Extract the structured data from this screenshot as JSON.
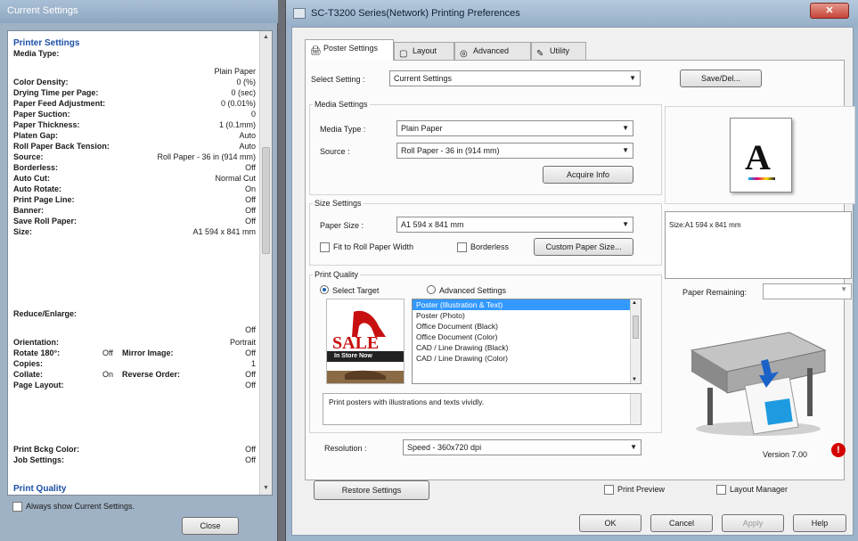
{
  "left_window": {
    "title": "Current Settings",
    "section_printer": "Printer Settings",
    "media_type_label": "Media Type:",
    "media_type_value": "Plain Paper",
    "rows1": [
      {
        "label": "Color Density:",
        "value": "0 (%)"
      },
      {
        "label": "Drying Time per Page:",
        "value": "0 (sec)"
      },
      {
        "label": "Paper Feed Adjustment:",
        "value": "0 (0.01%)"
      },
      {
        "label": "Paper Suction:",
        "value": "0"
      },
      {
        "label": "Paper Thickness:",
        "value": "1 (0.1mm)"
      },
      {
        "label": "Platen Gap:",
        "value": "Auto"
      },
      {
        "label": "Roll Paper Back Tension:",
        "value": "Auto"
      },
      {
        "label": "Source:",
        "value": "Roll Paper - 36 in (914 mm)"
      },
      {
        "label": "Borderless:",
        "value": "Off"
      },
      {
        "label": "Auto Cut:",
        "value": "Normal Cut"
      },
      {
        "label": "Auto Rotate:",
        "value": "On"
      },
      {
        "label": "Print Page Line:",
        "value": "Off"
      },
      {
        "label": "Banner:",
        "value": "Off"
      },
      {
        "label": "Save Roll Paper:",
        "value": "Off"
      },
      {
        "label": "Size:",
        "value": "A1 594 x 841 mm"
      }
    ],
    "reduce_label": "Reduce/Enlarge:",
    "reduce_value": "Off",
    "orientation_label": "Orientation:",
    "orientation_value": "Portrait",
    "rotate_label": "Rotate 180°:",
    "rotate_value": "Off",
    "mirror_label": "Mirror Image:",
    "mirror_value": "Off",
    "copies_label": "Copies:",
    "copies_value": "1",
    "collate_label": "Collate:",
    "collate_value": "On",
    "reverse_label": "Reverse Order:",
    "reverse_value": "Off",
    "page_layout_label": "Page Layout:",
    "page_layout_value": "Off",
    "print_bckg_label": "Print Bckg Color:",
    "print_bckg_value": "Off",
    "job_settings_label": "Job Settings:",
    "job_settings_value": "Off",
    "section_quality": "Print Quality",
    "always_show": "Always show Current Settings.",
    "close": "Close"
  },
  "right_window": {
    "title": "SC-T3200 Series(Network) Printing Preferences",
    "close_glyph": "✕",
    "tabs": [
      {
        "label": "Poster Settings",
        "icon": "🖨"
      },
      {
        "label": "Layout",
        "icon": "▢"
      },
      {
        "label": "Advanced",
        "icon": "◎"
      },
      {
        "label": "Utility",
        "icon": "✎"
      }
    ],
    "select_setting_label": "Select Setting :",
    "select_setting_value": "Current Settings",
    "save_del": "Save/Del...",
    "media_group": "Media Settings",
    "media_type_label": "Media Type :",
    "media_type_value": "Plain Paper",
    "source_label": "Source :",
    "source_value": "Roll Paper - 36 in (914 mm)",
    "acquire_info": "Acquire Info",
    "size_group": "Size Settings",
    "paper_size_label": "Paper Size :",
    "paper_size_value": "A1 594 x 841 mm",
    "fit_roll": "Fit to Roll Paper Width",
    "borderless": "Borderless",
    "custom_paper": "Custom Paper Size...",
    "quality_group": "Print Quality",
    "select_target": "Select Target",
    "advanced_settings": "Advanced Settings",
    "targets": [
      "Poster (Illustration & Text)",
      "Poster (Photo)",
      "Office Document (Black)",
      "Office Document (Color)",
      "CAD / Line Drawing (Black)",
      "CAD / Line Drawing (Color)"
    ],
    "sale_text": "SALE",
    "in_store_text": "In Store Now",
    "description": "Print posters with illustrations and texts vividly.",
    "resolution_label": "Resolution :",
    "resolution_value": "Speed - 360x720 dpi",
    "size_preview": "Size:A1 594 x 841 mm",
    "paper_remaining_label": "Paper Remaining:",
    "doc_letter": "A",
    "version": "Version 7.00",
    "alert_glyph": "!",
    "restore_settings": "Restore Settings",
    "print_preview": "Print Preview",
    "layout_manager": "Layout Manager",
    "ok": "OK",
    "cancel": "Cancel",
    "apply": "Apply",
    "help": "Help"
  }
}
